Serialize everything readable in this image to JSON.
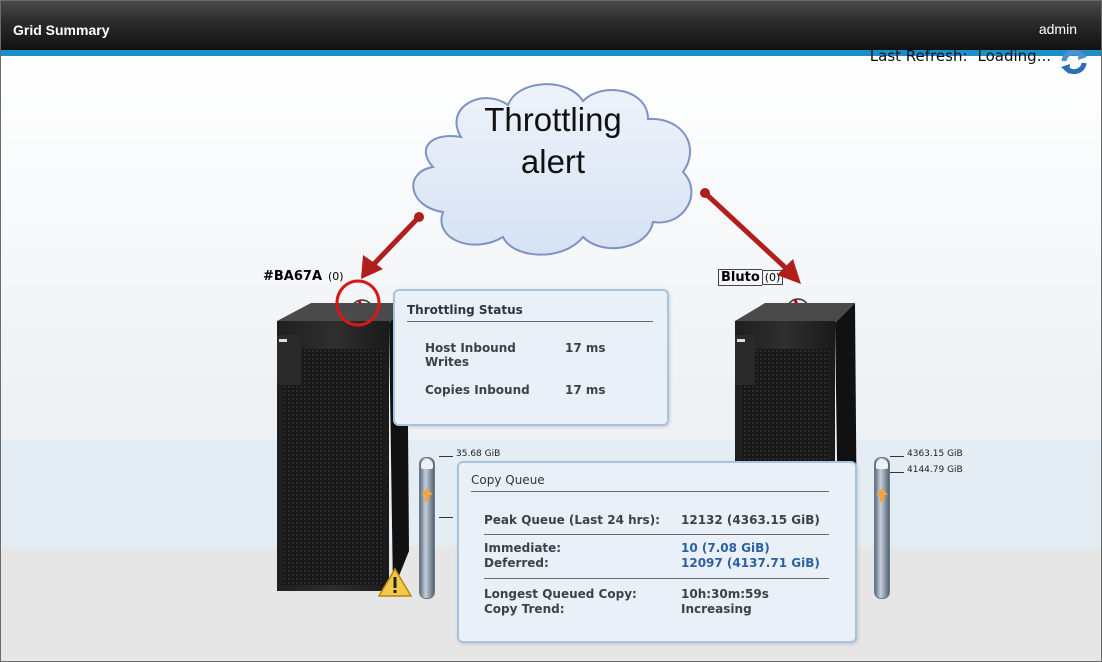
{
  "header": {
    "title": "Grid Summary",
    "user": "admin"
  },
  "refresh": {
    "label": "Last Refresh:",
    "status": "Loading...",
    "icon": "refresh-icon"
  },
  "annotation": {
    "line1": "Throttling",
    "line2": "alert",
    "color": "#b01e1e"
  },
  "nodes": [
    {
      "name": "#BA67A",
      "count": "(0)",
      "capacity_labels": [
        "35.68 GiB"
      ]
    },
    {
      "name": "Bluto",
      "count": "(0)",
      "capacity_labels": [
        "4363.15 GiB",
        "4144.79 GiB"
      ]
    }
  ],
  "throttling": {
    "title": "Throttling Status",
    "host_inbound_label": "Host Inbound",
    "host_inbound_label2": "Writes",
    "host_inbound_value": "17 ms",
    "copies_inbound_label": "Copies Inbound",
    "copies_inbound_value": "17 ms"
  },
  "copy_queue": {
    "title": "Copy Queue",
    "peak_label": "Peak Queue (Last 24 hrs):",
    "peak_value": "12132 (4363.15 GiB)",
    "immediate_label": "Immediate:",
    "immediate_value": "10 (7.08 GiB)",
    "deferred_label": "Deferred:",
    "deferred_value": "12097 (4137.71 GiB)",
    "longest_label": "Longest Queued Copy:",
    "longest_value": "10h:30m:59s",
    "trend_label": "Copy Trend:",
    "trend_value": "Increasing"
  },
  "colors": {
    "accent": "#1c8fc9",
    "link_blue": "#2e5fa3",
    "warning": "#f2c94c"
  }
}
